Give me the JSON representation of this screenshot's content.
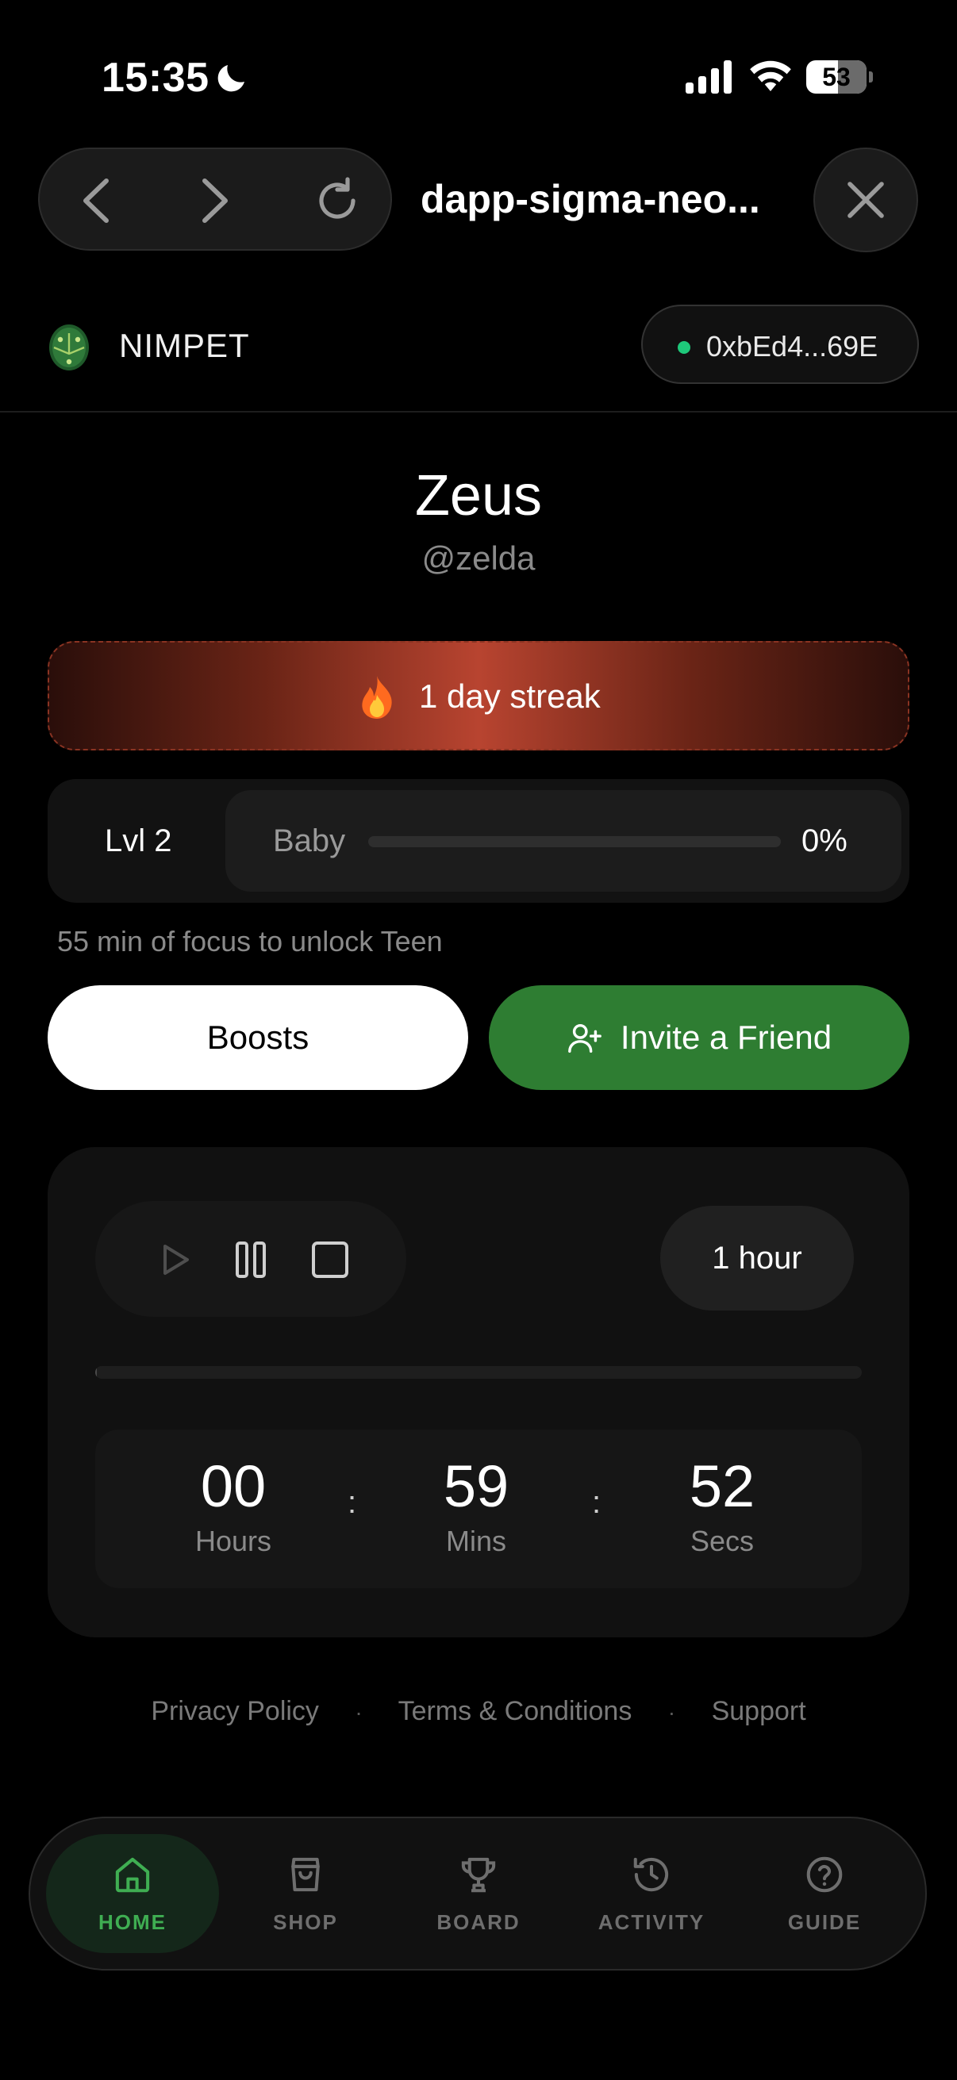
{
  "status_bar": {
    "time": "15:35",
    "battery": "53"
  },
  "browser": {
    "site_title": "dapp-sigma-neo..."
  },
  "header": {
    "app_name": "NIMPET",
    "wallet_address": "0xbEd4...69E",
    "wallet_status_color": "#1ec87a"
  },
  "profile": {
    "name": "Zeus",
    "handle": "@zelda"
  },
  "streak": {
    "label": "1 day streak"
  },
  "level": {
    "label": "Lvl 2",
    "stage": "Baby",
    "progress_percent": 0,
    "progress_text": "0%",
    "hint": "55 min of focus to unlock Teen"
  },
  "actions": {
    "boosts_label": "Boosts",
    "invite_label": "Invite a Friend",
    "accent_color": "#2e7d32"
  },
  "timer": {
    "duration_label": "1 hour",
    "elapsed_fraction": 0.002,
    "hours": "00",
    "hours_label": "Hours",
    "mins": "59",
    "mins_label": "Mins",
    "secs": "52",
    "secs_label": "Secs",
    "separator": ":"
  },
  "footer": {
    "privacy": "Privacy Policy",
    "terms": "Terms & Conditions",
    "support": "Support",
    "separator": "·"
  },
  "bottom_nav": {
    "items": [
      {
        "label": "HOME",
        "icon": "home-icon",
        "active": true
      },
      {
        "label": "SHOP",
        "icon": "shopping-bag-icon",
        "active": false
      },
      {
        "label": "BOARD",
        "icon": "trophy-icon",
        "active": false
      },
      {
        "label": "ACTIVITY",
        "icon": "history-icon",
        "active": false
      },
      {
        "label": "GUIDE",
        "icon": "help-circle-icon",
        "active": false
      }
    ]
  }
}
